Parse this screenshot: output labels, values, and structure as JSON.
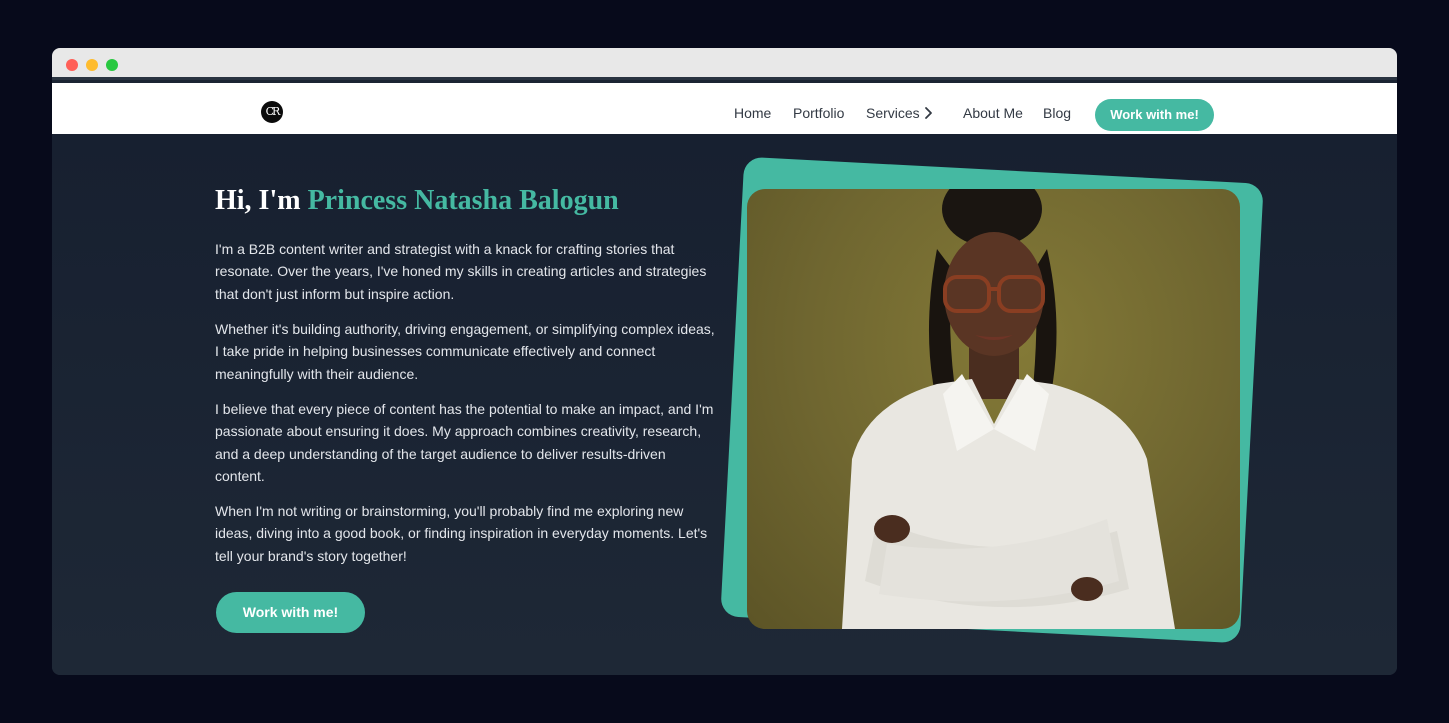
{
  "nav": {
    "logo_text": "CR",
    "links": [
      "Home",
      "Portfolio",
      "Services",
      "About Me",
      "Blog"
    ],
    "cta_label": "Work with me!"
  },
  "hero": {
    "heading_prefix": "Hi, I'm ",
    "heading_name": "Princess Natasha Balogun",
    "paragraphs": [
      "I'm a B2B content writer and strategist with a knack for crafting stories that resonate. Over the years, I've honed my skills in creating articles and strategies that don't just inform but inspire action.",
      "Whether it's building authority, driving engagement, or simplifying complex ideas, I take pride in helping businesses communicate effectively and connect meaningfully with their audience.",
      "I believe that every piece of content has the potential to make an impact, and I'm passionate about ensuring it does. My approach combines creativity, research, and a deep understanding of the target audience to deliver results-driven content.",
      "When I'm not writing or brainstorming, you'll probably find me exploring new ideas, diving into a good book, or finding inspiration in everyday moments. Let's tell your brand's story together!"
    ],
    "cta_label": "Work with me!"
  },
  "colors": {
    "accent": "#45b9a2",
    "page_background": "#070a1b",
    "hero_background": "#1b2433",
    "photo_background": "#7a7033"
  },
  "icons": {
    "services_chevron": "chevron-right-icon",
    "window_controls": [
      "close-dot",
      "minimize-dot",
      "maximize-dot"
    ]
  }
}
